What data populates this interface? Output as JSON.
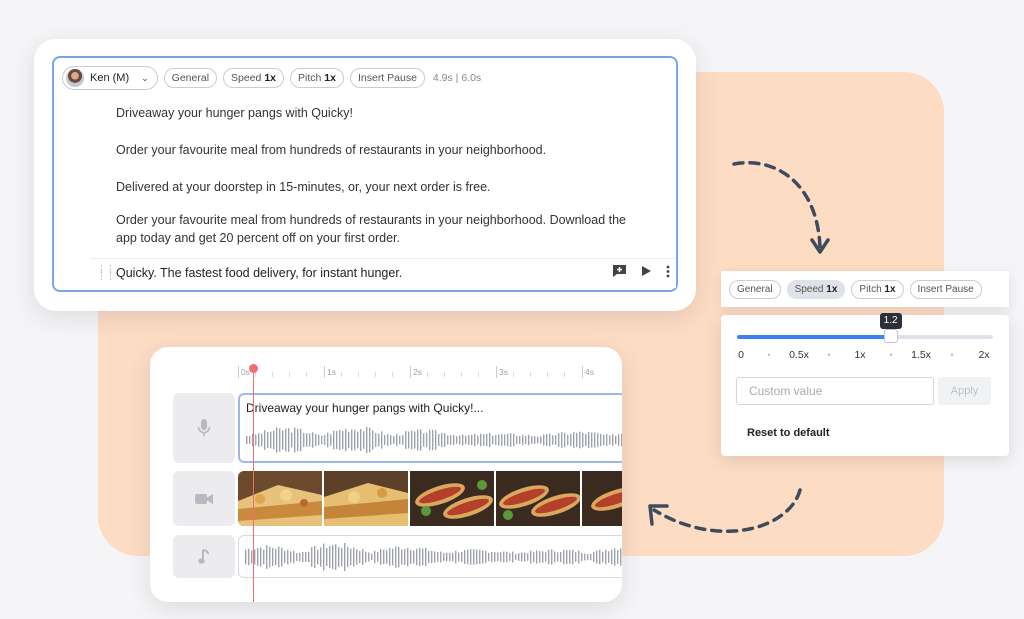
{
  "editor": {
    "voice_name": "Ken (M)",
    "tags": {
      "general": "General",
      "speed_label": "Speed",
      "speed_value": "1x",
      "pitch_label": "Pitch",
      "pitch_value": "1x",
      "insert_pause": "Insert Pause"
    },
    "duration": "4.9s | 6.0s",
    "lines": [
      "Driveaway your hunger pangs with Quicky!",
      "Order your favourite meal from hundreds of restaurants in your neighborhood.",
      "Delivered at your doorstep in 15-minutes, or, your next order is free.",
      "Order your favourite meal from hundreds of restaurants in your neighborhood. Download the app today and get 20 percent off on your first order."
    ],
    "highlight_line": "Quicky. The fastest food delivery, for instant hunger."
  },
  "speed_panel": {
    "tabs": {
      "general": "General",
      "speed_label": "Speed",
      "speed_value": "1x",
      "pitch_label": "Pitch",
      "pitch_value": "1x",
      "insert_pause": "Insert Pause"
    },
    "slider_value": 1.2,
    "slider_value_label": "1.2",
    "slider_fraction": 0.6,
    "ticks": [
      "0",
      "0.5x",
      "1x",
      "1.5x",
      "2x"
    ],
    "custom_placeholder": "Custom value",
    "apply_label": "Apply",
    "reset_label": "Reset to default",
    "accent_color": "#3b82f6"
  },
  "timeline": {
    "ruler_labels": [
      "0s",
      "1s",
      "2s",
      "3s",
      "4s"
    ],
    "voice_clip_title": "Driveaway your hunger pangs with Quicky!...",
    "tracks": [
      "mic-icon",
      "video-camera-icon",
      "music-note-icon"
    ]
  },
  "colors": {
    "peach": "#fddcc4",
    "selection_border": "#7aa6e0",
    "playhead": "#f26d6d"
  }
}
